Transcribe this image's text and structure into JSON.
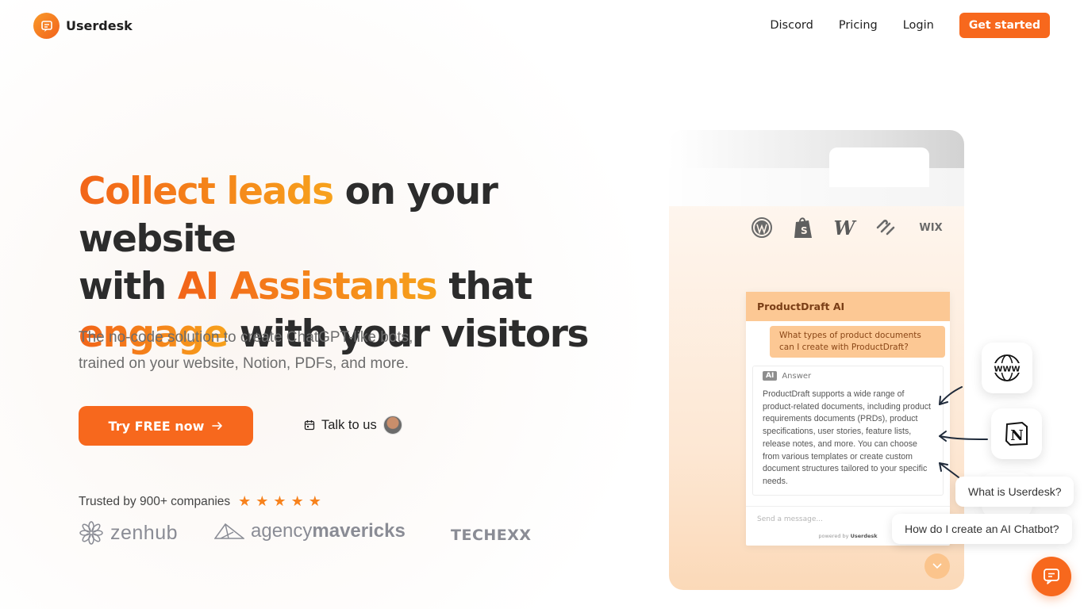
{
  "nav": {
    "brand": "Userdesk",
    "links": [
      "Discord",
      "Pricing",
      "Login"
    ],
    "cta": "Get started"
  },
  "hero": {
    "title_parts": [
      {
        "text": "Collect leads",
        "highlight": true
      },
      {
        "text": " on your website ",
        "highlight": false
      },
      {
        "text": "with ",
        "highlight": false
      },
      {
        "text": "AI Assistants",
        "highlight": true
      },
      {
        "text": " that ",
        "highlight": false
      },
      {
        "text": "engage",
        "highlight": true
      },
      {
        "text": " with your visitors",
        "highlight": false
      }
    ],
    "subtitle_line1": "The no-code solution to create ChatGPT-like bots,",
    "subtitle_line2": "trained on your website, Notion, PDFs, and more.",
    "primary_cta": "Try FREE now",
    "secondary_cta": "Talk to us"
  },
  "trust": {
    "text": "Trusted by 900+ companies",
    "stars": 5,
    "logos": {
      "zenhub": "zenhub",
      "agency_light": "agency",
      "agency_bold": "mavericks",
      "techexx": "TECHEXX"
    }
  },
  "mockup": {
    "platforms": [
      "wordpress-icon",
      "shopify-icon",
      "webflow-icon",
      "squarespace-icon",
      "wix-icon"
    ],
    "wix_label": "WIX",
    "webflow_label": "W",
    "chat": {
      "title": "ProductDraft AI",
      "question": "What types of product documents can I create with ProductDraft?",
      "ai_badge": "AI",
      "answer_label": "Answer",
      "answer": "ProductDraft supports a wide range of product-related documents, including product requirements documents (PRDs), product specifications, user stories, feature lists, release notes, and more. You can choose from various templates or create custom document structures tailored to your specific needs.",
      "input_placeholder": "Send a message...",
      "powered_prefix": "powered by",
      "powered_brand": "Userdesk"
    }
  },
  "floating": {
    "www_label": "WWW",
    "notion_label": "N",
    "suggestions": [
      "What is Userdesk?",
      "How do I create an AI Chatbot?"
    ]
  },
  "colors": {
    "accent": "#f7681d",
    "accent_light": "#fcc894",
    "text": "#2c2c2c"
  }
}
